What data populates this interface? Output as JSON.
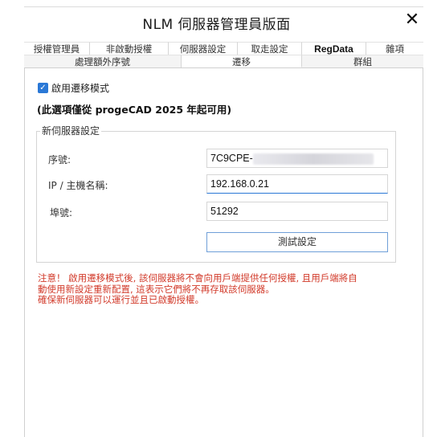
{
  "window": {
    "title": "NLM 伺服器管理員版面",
    "close_label": "✕"
  },
  "tabs_row1": [
    {
      "label": "授權管理員"
    },
    {
      "label": "非啟動授權"
    },
    {
      "label": "伺服器設定"
    },
    {
      "label": "取走設定"
    },
    {
      "label": "RegData"
    },
    {
      "label": "雜項"
    }
  ],
  "tabs_row2": [
    {
      "label": "處理額外序號"
    },
    {
      "label": "遷移",
      "active": true
    },
    {
      "label": "群組"
    }
  ],
  "migration": {
    "enable_label": "啟用遷移模式",
    "enabled": true,
    "availability_note": "(此選項僅從 progeCAD 2025 年起可用)"
  },
  "new_server": {
    "legend": "新伺服器設定",
    "serial_label": "序號:",
    "serial_value": "7C9CPE-",
    "host_label": "IP / 主機名稱:",
    "host_value": "192.168.0.21",
    "port_label": "埠號:",
    "port_value": "51292",
    "test_button": "測試設定"
  },
  "warning": [
    "注意！ 啟用遷移模式後, 該伺服器將不會向用戶端提供任何授權, 且用戶端將自",
    "動使用新設定重新配置, 這表示它們將不再存取該伺服器。",
    "確保新伺服器可以運行並且已啟動授權。"
  ],
  "colors": {
    "accent": "#2a78d6",
    "warning": "#d23a2a"
  }
}
